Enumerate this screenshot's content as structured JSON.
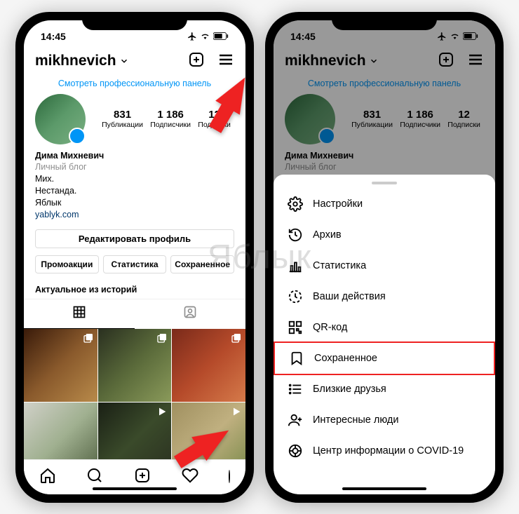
{
  "watermark": "Яблык",
  "status": {
    "time": "14:45"
  },
  "profile": {
    "username": "mikhnevich",
    "pro_panel": "Смотреть профессиональную панель",
    "stats": {
      "posts_num": "831",
      "posts_label": "Публикации",
      "followers_num": "1 186",
      "followers_label": "Подписчики",
      "following_num": "12",
      "following_label": "Подписки"
    },
    "bio": {
      "name": "Дима Михневич",
      "category": "Личный блог",
      "line1": "Мих.",
      "line2": "Нестанда.",
      "line3": "Яблык",
      "link": "yablyk.com"
    },
    "edit_label": "Редактировать профиль",
    "tabs": {
      "promo": "Промоакции",
      "stats": "Статистика",
      "saved": "Сохраненное"
    },
    "stories_title": "Актуальное из историй"
  },
  "menu": {
    "settings": "Настройки",
    "archive": "Архив",
    "stats": "Статистика",
    "activity": "Ваши действия",
    "qr": "QR-код",
    "saved": "Сохраненное",
    "close_friends": "Близкие друзья",
    "discover": "Интересные люди",
    "covid": "Центр информации о COVID-19"
  }
}
